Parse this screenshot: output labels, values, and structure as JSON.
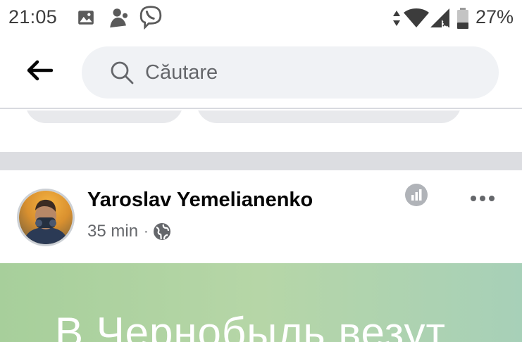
{
  "status_bar": {
    "time": "21:05",
    "battery": "27%",
    "icons": [
      "image-icon",
      "app-notification-icon",
      "viber-icon",
      "data-arrows-icon",
      "wifi-icon",
      "signal-icon",
      "battery-icon"
    ]
  },
  "header": {
    "back_icon": "back-arrow-icon",
    "search_icon": "search-icon",
    "search_placeholder": "Căutare",
    "search_value": ""
  },
  "post": {
    "author": "Yaroslav Yemelianenko",
    "time": "35 min",
    "separator": "·",
    "privacy_icon": "globe-icon",
    "insights_icon": "insights-icon",
    "more_icon": "more-icon",
    "image_text": "В Чернобыль везут"
  },
  "colors": {
    "background": "#ffffff",
    "search_bg": "#f0f2f5",
    "divider": "#dcdde1",
    "secondary_text": "#65676b",
    "post_image_green": "#b6d6a7"
  }
}
